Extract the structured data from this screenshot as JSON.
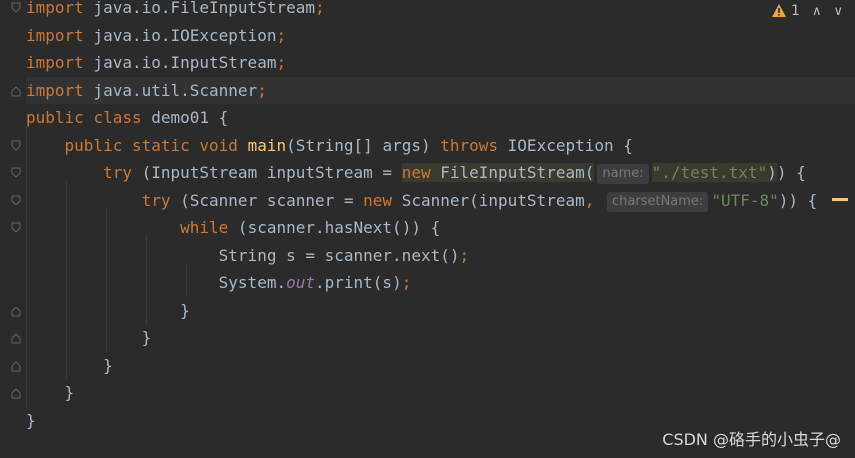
{
  "editor": {
    "lines": [
      {
        "segments": [
          {
            "t": "import",
            "c": "kw"
          },
          {
            "t": " java.io.FileInputStream"
          },
          {
            "t": ";",
            "c": "pun"
          }
        ]
      },
      {
        "segments": [
          {
            "t": "import",
            "c": "kw"
          },
          {
            "t": " java.io.IOException"
          },
          {
            "t": ";",
            "c": "pun"
          }
        ]
      },
      {
        "segments": [
          {
            "t": "import",
            "c": "kw"
          },
          {
            "t": " java.io.InputStream"
          },
          {
            "t": ";",
            "c": "pun"
          }
        ]
      },
      {
        "segments": [
          {
            "t": "import",
            "c": "kw"
          },
          {
            "t": " java.util.Scanner"
          },
          {
            "t": ";",
            "c": "pun"
          }
        ],
        "current": true
      },
      {
        "segments": [
          {
            "t": "public",
            "c": "kw"
          },
          {
            "t": " "
          },
          {
            "t": "class",
            "c": "kw"
          },
          {
            "t": " demo01 {"
          }
        ]
      },
      {
        "segments": [
          {
            "t": "    "
          },
          {
            "t": "public",
            "c": "kw"
          },
          {
            "t": " "
          },
          {
            "t": "static",
            "c": "kw"
          },
          {
            "t": " "
          },
          {
            "t": "void",
            "c": "kw"
          },
          {
            "t": " "
          },
          {
            "t": "main",
            "c": "fn"
          },
          {
            "t": "(String[] args) "
          },
          {
            "t": "throws",
            "c": "kw"
          },
          {
            "t": " IOException {"
          }
        ]
      },
      {
        "segments": [
          {
            "t": "        "
          },
          {
            "t": "try",
            "c": "kw"
          },
          {
            "t": " (InputStream inputStream = "
          },
          {
            "t": "new",
            "c": "kw hl-new"
          },
          {
            "t": " FileInputStream(",
            "c": "hl-new"
          },
          {
            "hint": "name:"
          },
          {
            "t": "\"./test.txt\"",
            "c": "str strbox"
          },
          {
            "t": ")",
            "c": "hl-new"
          },
          {
            "t": ") {"
          }
        ]
      },
      {
        "segments": [
          {
            "t": "            "
          },
          {
            "t": "try",
            "c": "kw"
          },
          {
            "t": " (Scanner scanner = "
          },
          {
            "t": "new",
            "c": "kw"
          },
          {
            "t": " Scanner(inputStream"
          },
          {
            "t": ",",
            "c": "pun"
          },
          {
            "t": " "
          },
          {
            "hint": "charsetName:"
          },
          {
            "t": "\"UTF-8\"",
            "c": "str"
          },
          {
            "t": ")) {"
          }
        ]
      },
      {
        "segments": [
          {
            "t": "                "
          },
          {
            "t": "while",
            "c": "kw"
          },
          {
            "t": " (scanner.hasNext()) {"
          }
        ]
      },
      {
        "segments": [
          {
            "t": "                    String s = scanner.next()"
          },
          {
            "t": ";",
            "c": "pun"
          }
        ]
      },
      {
        "segments": [
          {
            "t": "                    System."
          },
          {
            "t": "out",
            "c": "field"
          },
          {
            "t": ".print(s)"
          },
          {
            "t": ";",
            "c": "pun"
          }
        ]
      },
      {
        "segments": [
          {
            "t": "                }"
          }
        ]
      },
      {
        "segments": [
          {
            "t": "            }"
          }
        ]
      },
      {
        "segments": [
          {
            "t": "        }"
          }
        ]
      },
      {
        "segments": [
          {
            "t": "    }"
          }
        ]
      },
      {
        "segments": [
          {
            "t": "}"
          }
        ]
      }
    ],
    "fold_markers": [
      {
        "line": 0,
        "type": "open"
      },
      {
        "line": 3,
        "type": "close"
      },
      {
        "line": 5,
        "type": "open"
      },
      {
        "line": 6,
        "type": "open"
      },
      {
        "line": 7,
        "type": "open"
      },
      {
        "line": 8,
        "type": "open"
      },
      {
        "line": 11,
        "type": "close"
      },
      {
        "line": 12,
        "type": "close"
      },
      {
        "line": 13,
        "type": "close"
      },
      {
        "line": 14,
        "type": "close"
      }
    ]
  },
  "inspection": {
    "count": "1",
    "icon": "warning-icon",
    "up_icon": "chevron-up-icon",
    "down_icon": "chevron-down-icon"
  },
  "watermark": "CSDN @硌手的小虫子@",
  "colors": {
    "background": "#2b2b2b",
    "keyword": "#cc7832",
    "text": "#a9b7c6",
    "string": "#6a8759",
    "method": "#ffc66d",
    "field": "#9876aa",
    "warning": "#f0a732"
  }
}
